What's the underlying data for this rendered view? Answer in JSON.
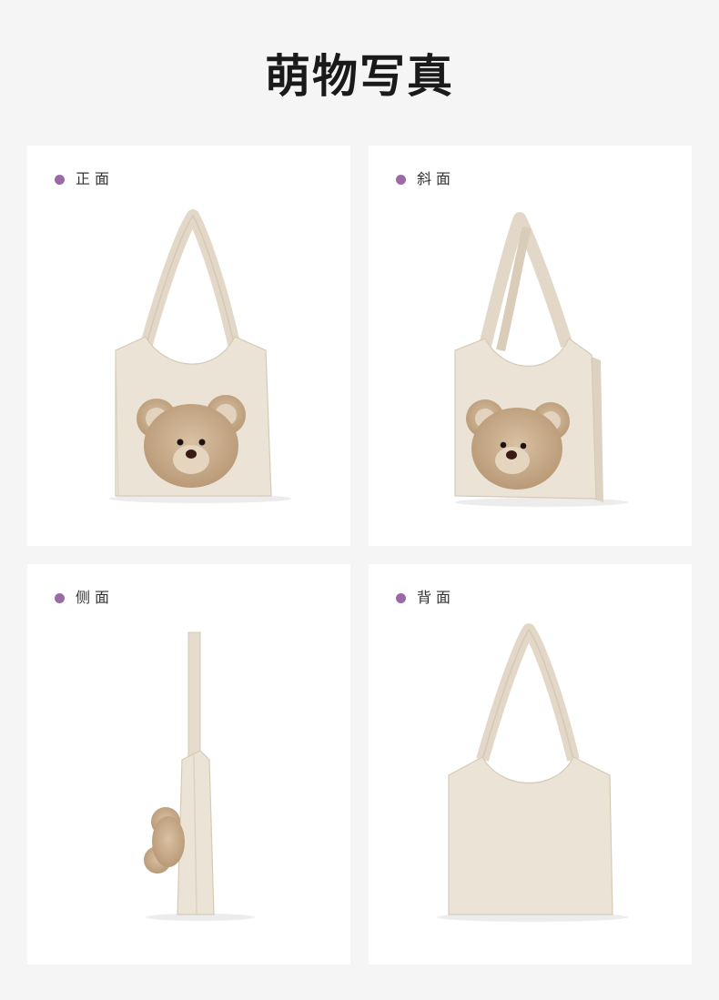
{
  "page": {
    "title": "萌物写真"
  },
  "colors": {
    "background": "#f5f5f5",
    "card": "#ffffff",
    "label_dot": "#9b6aa6",
    "bag_canvas": "#ebe2d4",
    "bear_fur": "#c9ad8c"
  },
  "views": [
    {
      "label": "正面",
      "icon": "bear-tote-front-icon"
    },
    {
      "label": "斜面",
      "icon": "bear-tote-angled-icon"
    },
    {
      "label": "侧面",
      "icon": "bear-tote-side-icon"
    },
    {
      "label": "背面",
      "icon": "bear-tote-back-icon"
    }
  ]
}
